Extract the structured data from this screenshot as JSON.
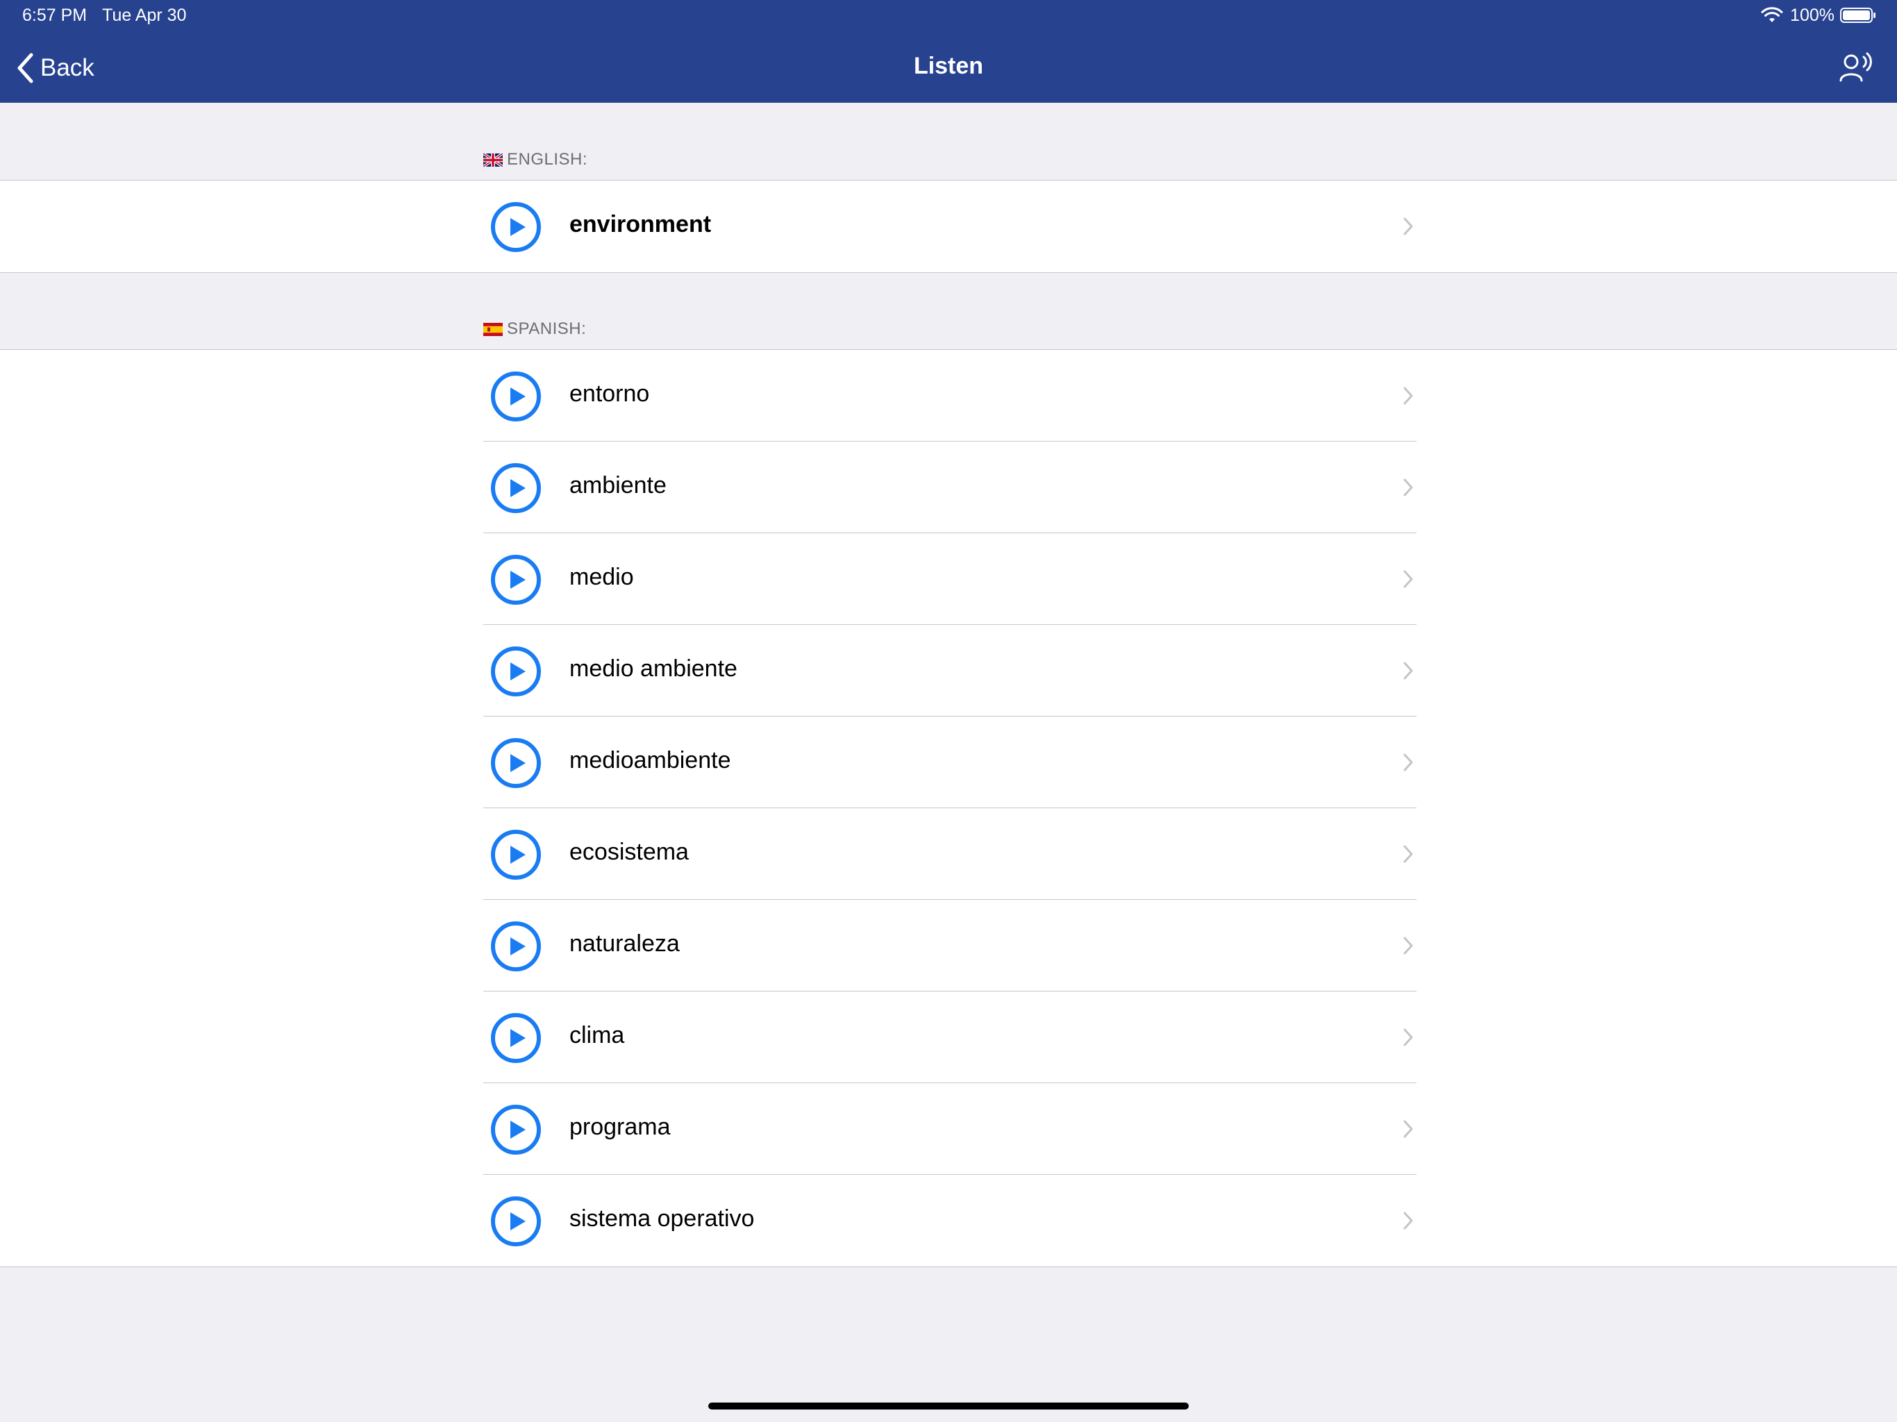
{
  "status_bar": {
    "time": "6:57 PM",
    "date": "Tue Apr 30",
    "battery": "100%"
  },
  "nav": {
    "back_label": "Back",
    "title": "Listen"
  },
  "sections": {
    "english": {
      "header": "ENGLISH:",
      "items": [
        {
          "label": "environment"
        }
      ]
    },
    "spanish": {
      "header": "SPANISH:",
      "items": [
        {
          "label": "entorno"
        },
        {
          "label": "ambiente"
        },
        {
          "label": "medio"
        },
        {
          "label": "medio ambiente"
        },
        {
          "label": "medioambiente"
        },
        {
          "label": "ecosistema"
        },
        {
          "label": "naturaleza"
        },
        {
          "label": "clima"
        },
        {
          "label": "programa"
        },
        {
          "label": "sistema operativo"
        }
      ]
    }
  },
  "icons": {
    "back": "chevron-left-icon",
    "voice": "speaking-person-icon",
    "play": "play-circle-icon",
    "row_chevron": "chevron-right-icon"
  },
  "colors": {
    "nav_bar": "#27428f",
    "accent": "#1a7cf2",
    "background": "#efeff4"
  }
}
